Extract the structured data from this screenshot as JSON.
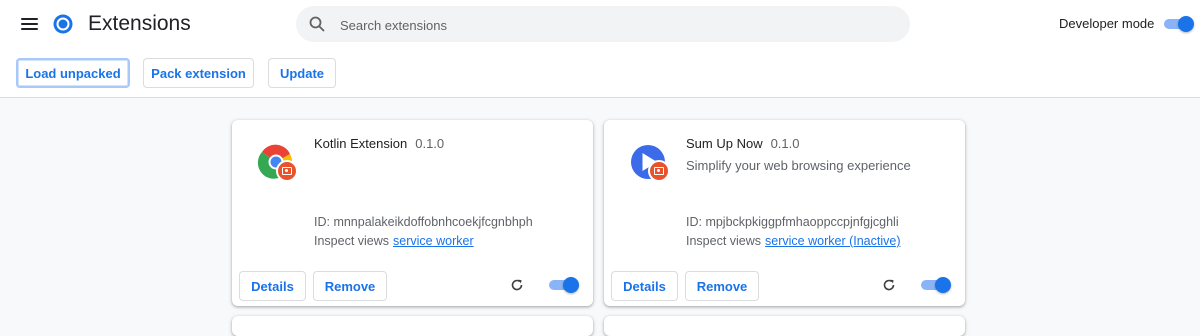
{
  "header": {
    "title": "Extensions",
    "search_placeholder": "Search extensions",
    "developer_mode_label": "Developer mode",
    "developer_mode_on": true
  },
  "toolbar": {
    "load_unpacked": "Load unpacked",
    "pack_extension": "Pack extension",
    "update": "Update"
  },
  "extensions": [
    {
      "name": "Kotlin Extension",
      "version": "0.1.0",
      "description": "",
      "id_text": "ID: mnnpalakeikdoffobnhcoekjfcgnbhph",
      "inspect_label": "Inspect views",
      "inspect_link": "service worker",
      "details_label": "Details",
      "remove_label": "Remove",
      "enabled": true,
      "icon": "chrome-logo-icon"
    },
    {
      "name": "Sum Up Now",
      "version": "0.1.0",
      "description": "Simplify your web browsing experience",
      "id_text": "ID: mpjbckpkiggpfmhaoppccpjnfgjcghli",
      "inspect_label": "Inspect views",
      "inspect_link": "service worker (Inactive)",
      "details_label": "Details",
      "remove_label": "Remove",
      "enabled": true,
      "icon": "play-icon"
    }
  ],
  "colors": {
    "accent": "#1a73e8",
    "toggle_track": "#8ab4f8",
    "badge": "#e8532c"
  }
}
